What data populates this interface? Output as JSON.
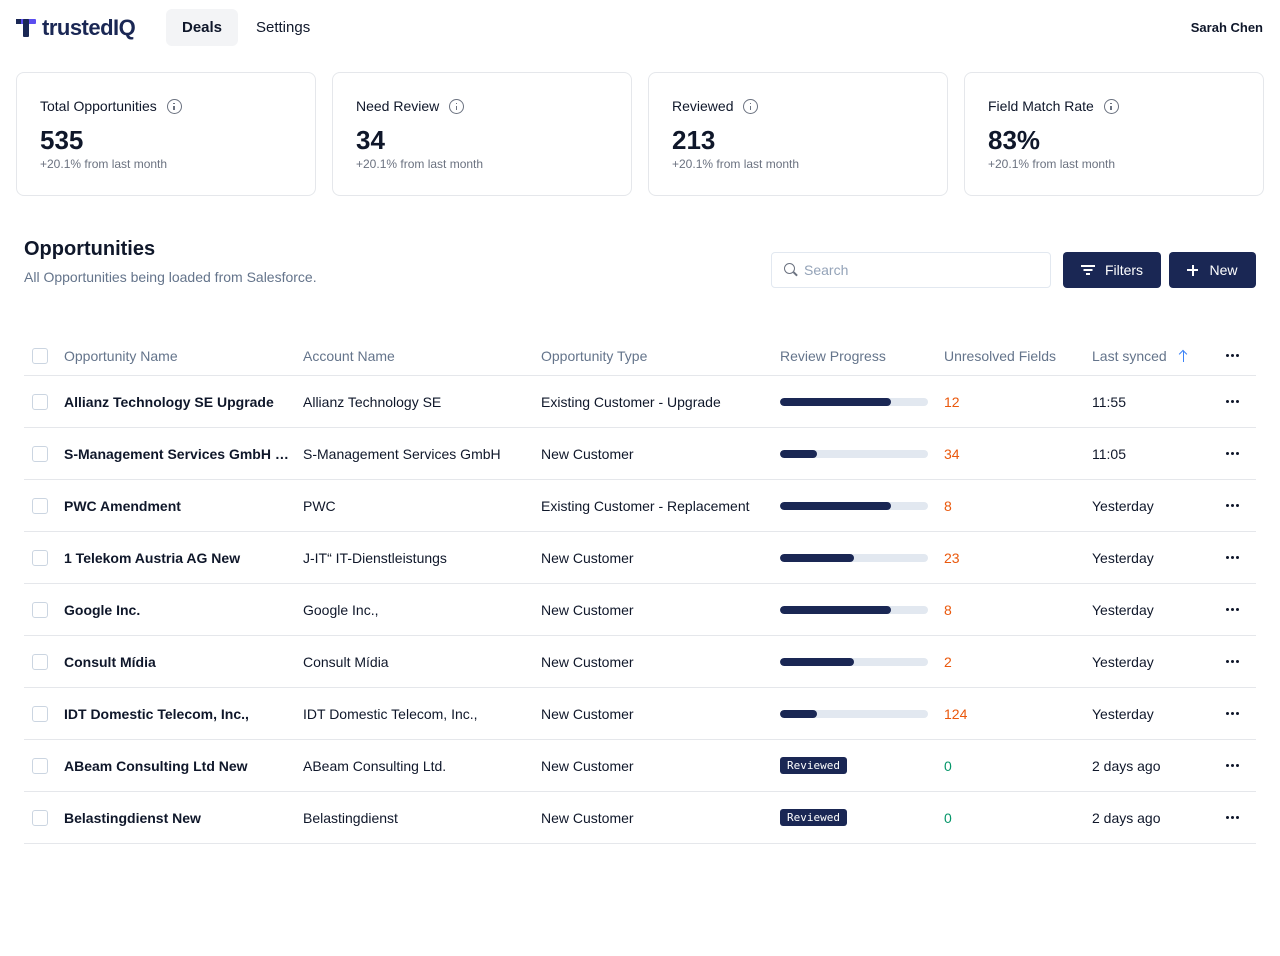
{
  "app": {
    "logo_text": "trustedIQ",
    "user_name": "Sarah Chen"
  },
  "nav": {
    "tabs": [
      {
        "label": "Deals",
        "active": true
      },
      {
        "label": "Settings",
        "active": false
      }
    ]
  },
  "stats": [
    {
      "title": "Total Opportunities",
      "value": "535",
      "sub": "+20.1% from last month"
    },
    {
      "title": "Need Review",
      "value": "34",
      "sub": "+20.1% from last month"
    },
    {
      "title": "Reviewed",
      "value": "213",
      "sub": "+20.1% from last month"
    },
    {
      "title": "Field Match Rate",
      "value": "83%",
      "sub": "+20.1% from last month"
    }
  ],
  "section": {
    "title": "Opportunities",
    "subtitle": "All Opportunities being loaded from Salesforce.",
    "search_placeholder": "Search",
    "filters_label": "Filters",
    "new_label": "New"
  },
  "table": {
    "columns": [
      "Opportunity Name",
      "Account Name",
      "Opportunity Type",
      "Review Progress",
      "Unresolved Fields",
      "Last synced"
    ],
    "rows": [
      {
        "name": "Allianz Technology SE Upgrade",
        "account": "Allianz Technology SE",
        "type": "Existing Customer - Upgrade",
        "progress": 0.75,
        "reviewed": false,
        "unresolved": "12",
        "synced": "11:55"
      },
      {
        "name": "S-Management Services GmbH New",
        "account": "S-Management Services GmbH",
        "type": "New Customer",
        "progress": 0.25,
        "reviewed": false,
        "unresolved": "34",
        "synced": "11:05"
      },
      {
        "name": "PWC Amendment",
        "account": "PWC",
        "type": "Existing Customer - Replacement",
        "progress": 0.75,
        "reviewed": false,
        "unresolved": "8",
        "synced": "Yesterday"
      },
      {
        "name": "1 Telekom Austria AG New",
        "account": "J-IT“ IT-Dienstleistungs",
        "type": "New Customer",
        "progress": 0.5,
        "reviewed": false,
        "unresolved": "23",
        "synced": "Yesterday"
      },
      {
        "name": "Google Inc.",
        "account": "Google Inc.,",
        "type": "New Customer",
        "progress": 0.75,
        "reviewed": false,
        "unresolved": "8",
        "synced": "Yesterday"
      },
      {
        "name": "Consult Mídia",
        "account": "Consult Mídia",
        "type": "New Customer",
        "progress": 0.5,
        "reviewed": false,
        "unresolved": "2",
        "synced": "Yesterday"
      },
      {
        "name": "IDT Domestic Telecom, Inc.,",
        "account": "IDT Domestic Telecom, Inc.,",
        "type": "New Customer",
        "progress": 0.25,
        "reviewed": false,
        "unresolved": "124",
        "synced": "Yesterday"
      },
      {
        "name": "ABeam Consulting Ltd New",
        "account": "ABeam Consulting Ltd.",
        "type": "New Customer",
        "progress": 1,
        "reviewed": true,
        "reviewed_label": "Reviewed",
        "unresolved": "0",
        "synced": "2 days ago"
      },
      {
        "name": "Belastingdienst New",
        "account": "Belastingdienst",
        "type": "New Customer",
        "progress": 1,
        "reviewed": true,
        "reviewed_label": "Reviewed",
        "unresolved": "0",
        "synced": "2 days ago"
      }
    ]
  },
  "colors": {
    "brand_navy": "#1a2754",
    "brand_purple": "#5b4df0",
    "warning": "#ea580c",
    "success": "#059669",
    "sort_blue": "#3b82f6"
  }
}
